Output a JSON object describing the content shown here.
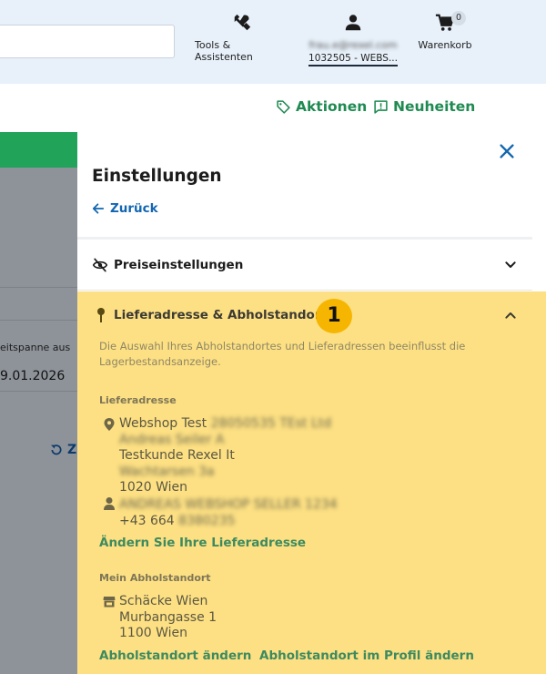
{
  "header": {
    "tools_label": "Tools & Assistenten",
    "account_email": "frau.e@rexel.com",
    "account_id": "1032505 - WEBS...",
    "cart_label": "Warenkorb",
    "cart_count": "0"
  },
  "links": {
    "aktionen": "Aktionen",
    "neuheiten": "Neuheiten"
  },
  "background": {
    "timespan_label": "eitspanne aus",
    "date_value": "9.01.2026",
    "reset_label": "Z"
  },
  "panel": {
    "title": "Einstellungen",
    "back_label": "Zurück",
    "price_settings_label": "Preiseinstellungen",
    "address_section": {
      "title": "Lieferadresse & Abholstandort",
      "step_number": "1",
      "info_text": "Die Auswahl Ihres Abholstandortes und Lieferadressen beeinflusst die Lagerbestandsanzeige.",
      "delivery_heading": "Lieferadresse",
      "delivery_name": "Webshop Test",
      "delivery_name_blurred": "28050535 TEst Ltd",
      "delivery_line2_blurred": "Andreas Seiler A",
      "delivery_line3": "Testkunde Rexel It",
      "delivery_line4_blurred": "Wachtarsen 3a",
      "delivery_city": "1020 Wien",
      "contact_name_blurred": "ANDREAS WEBSHOP SELLER 1234",
      "contact_phone_prefix": "+43 664",
      "contact_phone_blurred": "8380235",
      "change_delivery_link": "Ändern Sie Ihre Lieferadresse",
      "pickup_heading": "Mein Abholstandort",
      "pickup_name": "Schäcke Wien",
      "pickup_street": "Murbangasse 1",
      "pickup_city": "1100 Wien",
      "change_pickup_link": "Abholstandort ändern",
      "profile_pickup_link": "Abholstandort im Profil ändern"
    }
  },
  "colors": {
    "header_bg": "#e8f1fa",
    "brand_green": "#1f8a52",
    "link_blue": "#1266b0",
    "highlight_yellow": "#fde083",
    "badge_yellow": "#f6b500"
  }
}
